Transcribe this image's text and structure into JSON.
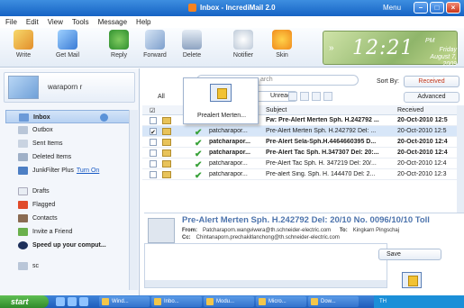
{
  "window": {
    "title": "Inbox - IncrediMail 2.0",
    "menu_label": "Menu"
  },
  "menubar": [
    "File",
    "Edit",
    "View",
    "Tools",
    "Message",
    "Help"
  ],
  "toolbar": {
    "write": "Write",
    "get_mail": "Get Mail",
    "reply": "Reply",
    "forward": "Forward",
    "delete": "Delete",
    "notifier": "Notifier",
    "skin": "Skin"
  },
  "clock": {
    "time": "12:21",
    "ampm": "PM",
    "day": "Friday",
    "date": "August 7, 2009"
  },
  "profile": {
    "username": "waraporn r"
  },
  "folders": [
    {
      "label": "Inbox",
      "selected": true
    },
    {
      "label": "Outbox"
    },
    {
      "label": "Sent Items"
    },
    {
      "label": "Deleted Items"
    },
    {
      "label": "JunkFilter Plus",
      "link": "Turn On"
    },
    {
      "label": "Drafts"
    },
    {
      "label": "Flagged"
    },
    {
      "label": "Contacts"
    },
    {
      "label": "Invite a Friend"
    },
    {
      "label": "Speed up your comput...",
      "bold": true
    },
    {
      "label": "sc"
    }
  ],
  "listbar": {
    "search": "arch",
    "sort_by": "Sort By:",
    "received": "Received",
    "all": "All",
    "unread": "Unread",
    "advanced": "Advanced"
  },
  "columns": {
    "subject": "Subject",
    "received": "Received"
  },
  "messages": [
    {
      "from": "",
      "subject": "Fw: Pre-Alert Merten Sph. H.242792 ...",
      "date": "20-Oct-2010 12:5",
      "bold": true
    },
    {
      "from": "patcharapor...",
      "subject": "Pre-Alert Merten Sph. H.242792 Del: ...",
      "date": "20-Oct-2010 12:5",
      "selected": true
    },
    {
      "from": "patcharapor...",
      "subject": "Pre-Alert Sela-Sph.H.4464660395 D...",
      "date": "20-Oct-2010 12:4",
      "bold": true
    },
    {
      "from": "patcharapor...",
      "subject": "Pre-Alert Tac Sph. H.347307 Del: 20:...",
      "date": "20-Oct-2010 12:4",
      "bold": true
    },
    {
      "from": "patcharapor...",
      "subject": "Pre-Alert Tac Sph. H. 347219 Del: 20/...",
      "date": "20-Oct-2010 12:4"
    },
    {
      "from": "patcharapor...",
      "subject": "Pre-alert Sing. Sph. H. 144470 Del: 2...",
      "date": "20-Oct-2010 12:3"
    }
  ],
  "popup": {
    "label": "Prealert Merten..."
  },
  "preview": {
    "subject": "Pre-Alert Merten Sph. H.242792 Del: 20/10 No. 0096/10/10 Toll",
    "from_label": "From:",
    "from": "Patcharaporn.wangviwera@th.schneider-electric.com",
    "to_label": "To:",
    "to": "Kingkarn Pingschaj",
    "cc_label": "Cc:",
    "cc": "Chintanaporn.prechakitlanchong@th.schneider-electric.com"
  },
  "compose": {
    "save": "Save"
  },
  "taskbar": {
    "start": "start",
    "tasks": [
      "Wind...",
      "Inbo...",
      "Modu...",
      "Micro...",
      "Dow..."
    ],
    "tray": "TH"
  }
}
